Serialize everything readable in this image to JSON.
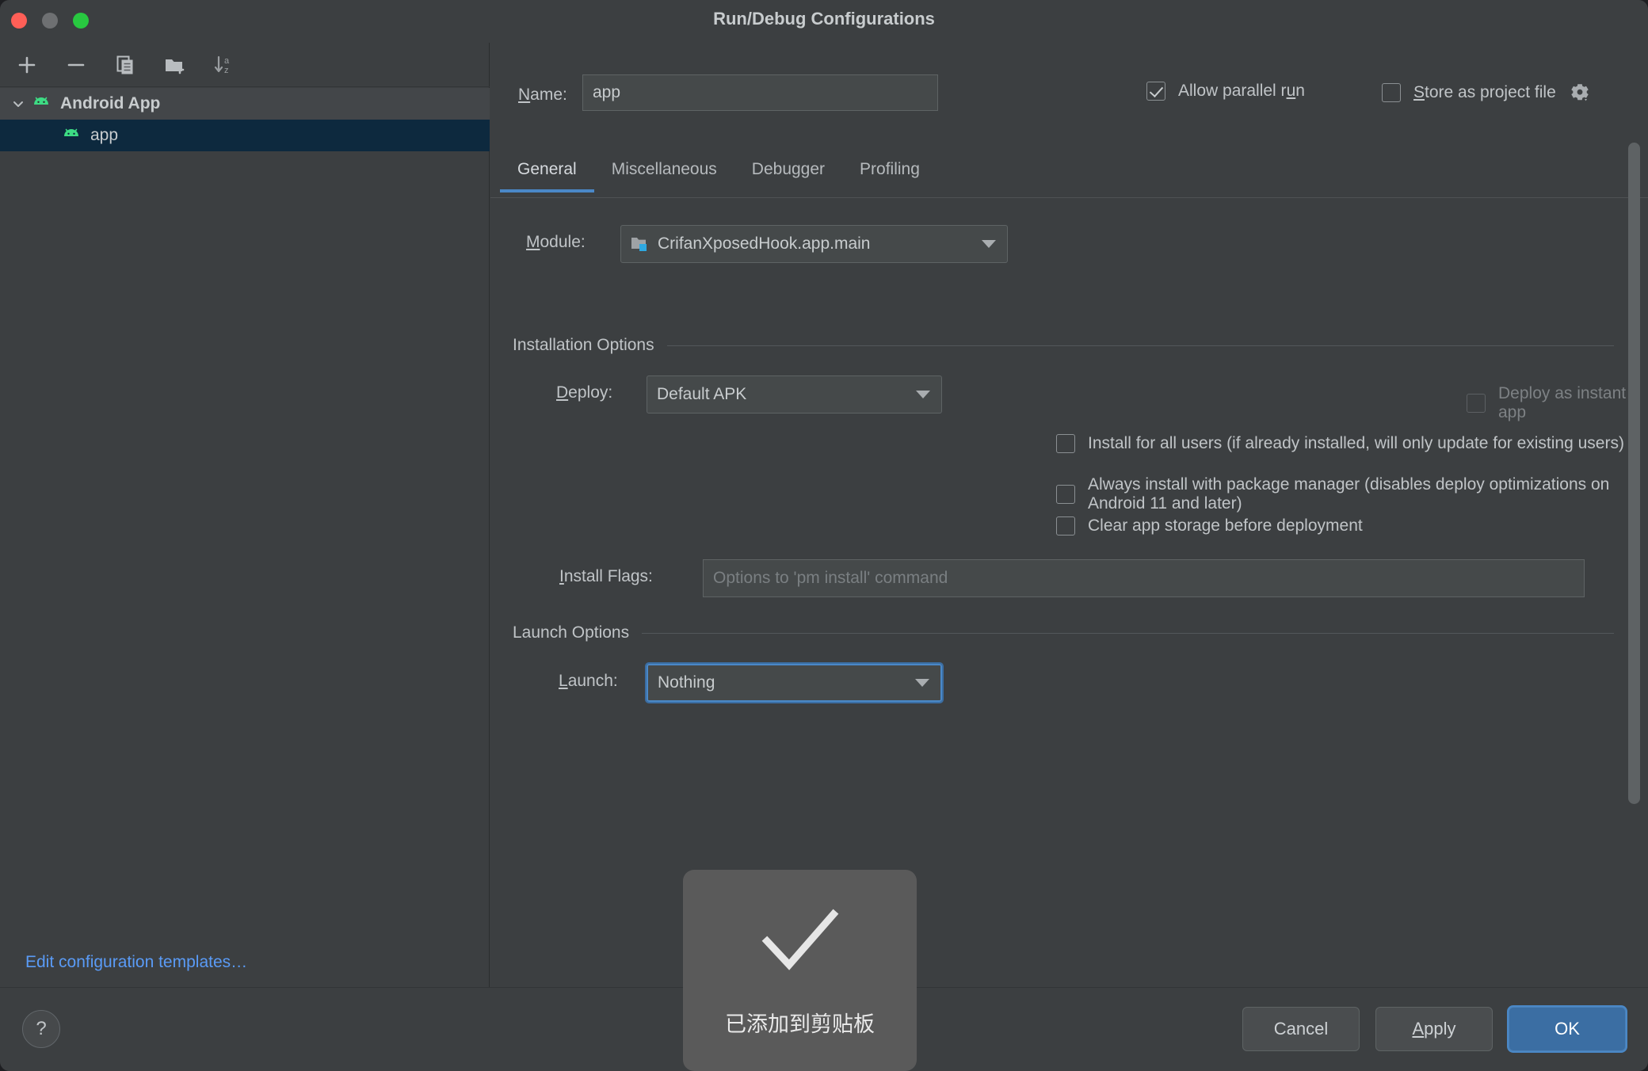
{
  "window": {
    "title": "Run/Debug Configurations",
    "traffic_lights": [
      "close",
      "minimize",
      "maximize"
    ]
  },
  "sidebar": {
    "toolbar": [
      {
        "name": "add-configuration-button",
        "icon": "plus-icon"
      },
      {
        "name": "remove-configuration-button",
        "icon": "minus-icon"
      },
      {
        "name": "copy-configuration-button",
        "icon": "copy-icon"
      },
      {
        "name": "new-folder-button",
        "icon": "folder-add-icon"
      },
      {
        "name": "sort-configurations-button",
        "icon": "sort-az-icon"
      }
    ],
    "tree": [
      {
        "label": "Android App",
        "type": "group",
        "expanded": true,
        "icon": "android-icon"
      },
      {
        "label": "app",
        "type": "child",
        "selected": true,
        "icon": "android-icon"
      }
    ],
    "edit_templates_link": "Edit configuration templates…"
  },
  "form": {
    "name_label": "Name:",
    "name_value": "app",
    "allow_parallel_run_label": "Allow parallel run",
    "allow_parallel_run_checked": true,
    "store_as_project_file_label": "Store as project file",
    "store_as_project_file_checked": false,
    "store_gear_icon": "gear-icon",
    "tabs": [
      {
        "label": "General",
        "active": true
      },
      {
        "label": "Miscellaneous",
        "active": false
      },
      {
        "label": "Debugger",
        "active": false
      },
      {
        "label": "Profiling",
        "active": false
      }
    ],
    "module_label": "Module:",
    "module_value": "CrifanXposedHook.app.main",
    "installation_options_title": "Installation Options",
    "deploy_label": "Deploy:",
    "deploy_value": "Default APK",
    "deploy_instant_app_label": "Deploy as instant app",
    "deploy_instant_app_checked": false,
    "deploy_instant_app_disabled": true,
    "checkboxes": [
      {
        "label": "Install for all users (if already installed, will only update for existing users)",
        "checked": false
      },
      {
        "label": "Always install with package manager (disables deploy optimizations on Android 11 and later)",
        "checked": false
      },
      {
        "label": "Clear app storage before deployment",
        "checked": false
      }
    ],
    "install_flags_label": "Install Flags:",
    "install_flags_value": "",
    "install_flags_placeholder": "Options to 'pm install' command",
    "launch_options_title": "Launch Options",
    "launch_label": "Launch:",
    "launch_value": "Nothing",
    "launch_focused": true
  },
  "footer": {
    "help_label": "?",
    "cancel_label": "Cancel",
    "apply_label": "Apply",
    "ok_label": "OK"
  },
  "toast": {
    "icon": "checkmark-icon",
    "message": "已添加到剪贴板"
  },
  "colors": {
    "window_bg": "#3c3f41",
    "accent_blue": "#4a88c7",
    "link_blue": "#5a9bf6",
    "selection_blue": "#0d293e",
    "android_green": "#3ddc84",
    "text": "#c8ccce"
  }
}
